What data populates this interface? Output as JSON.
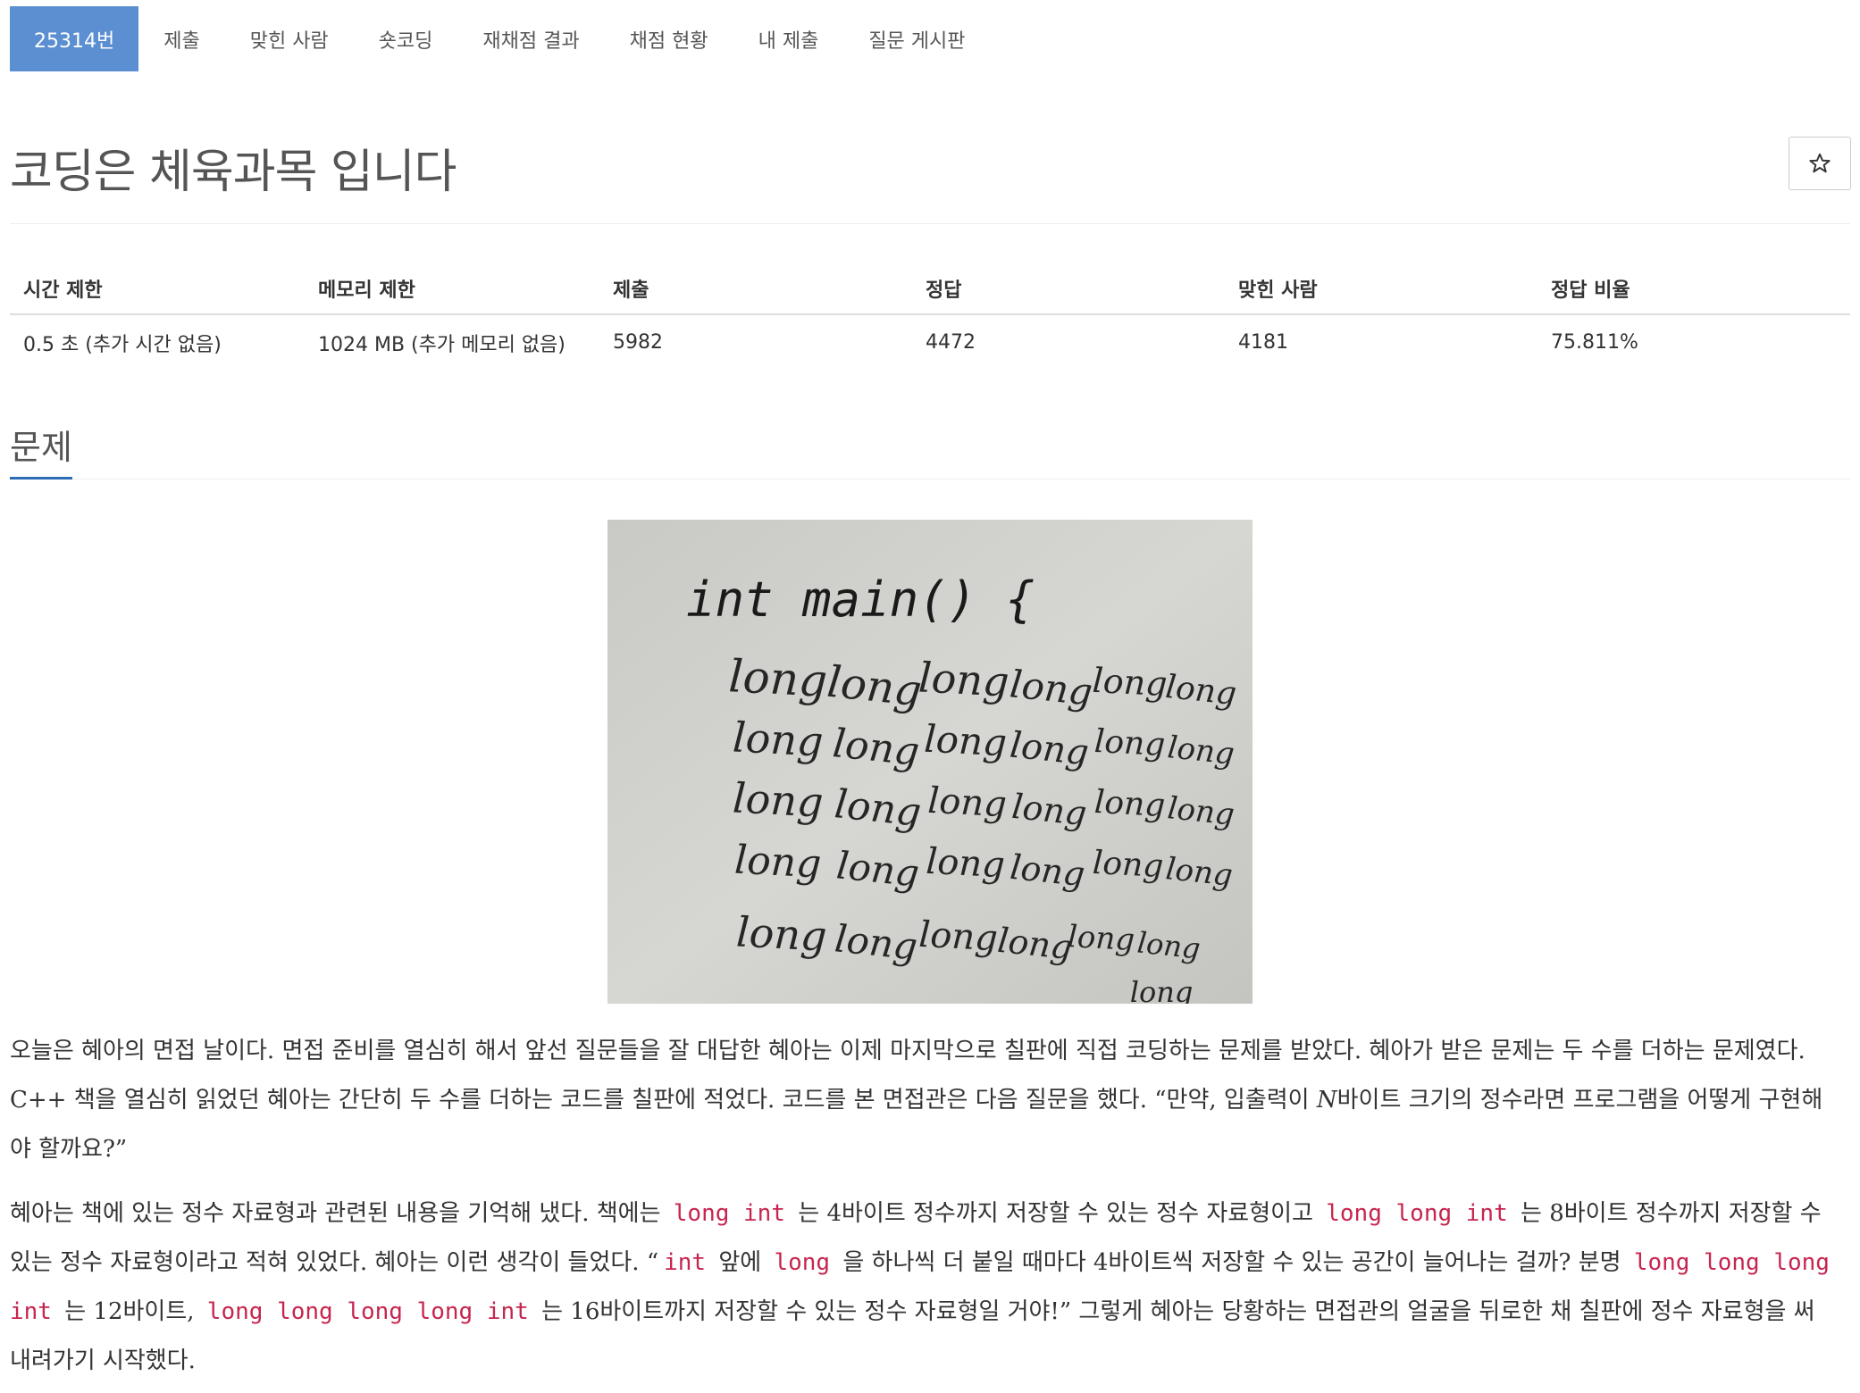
{
  "nav": {
    "tabs": [
      {
        "label": "25314번",
        "active": true
      },
      {
        "label": "제출",
        "active": false
      },
      {
        "label": "맞힌 사람",
        "active": false
      },
      {
        "label": "숏코딩",
        "active": false
      },
      {
        "label": "재채점 결과",
        "active": false
      },
      {
        "label": "채점 현황",
        "active": false
      },
      {
        "label": "내 제출",
        "active": false
      },
      {
        "label": "질문 게시판",
        "active": false
      }
    ]
  },
  "problem": {
    "title": "코딩은 체육과목 입니다",
    "star_icon": "star-outline-icon"
  },
  "stats": {
    "headers": [
      "시간 제한",
      "메모리 제한",
      "제출",
      "정답",
      "맞힌 사람",
      "정답 비율"
    ],
    "values": [
      "0.5 초 (추가 시간 없음)",
      "1024 MB (추가 메모리 없음)",
      "5982",
      "4472",
      "4181",
      "75.811%"
    ]
  },
  "section": {
    "heading": "문제"
  },
  "image": {
    "header_line": "int main() {",
    "word": "long"
  },
  "text": {
    "p1_a": "오늘은 혜아의 면접 날이다. 면접 준비를 열심히 해서 앞선 질문들을 잘 대답한 혜아는 이제 마지막으로 칠판에 직접 코딩하는 문제를 받았다. 혜아가 받은 문제는 두 수를 더하는 문제였다. C++ 책을 열심히 읽었던 혜아는 간단히 두 수를 더하는 코드를 칠판에 적었다. 코드를 본 면접관은 다음 질문을 했다. “만약, 입출력이 ",
    "p1_n": "N",
    "p1_b": "바이트 크기의 정수라면 프로그램을 어떻게 구현해야 할까요?”",
    "p2_1": "혜아는 책에 있는 정수 자료형과 관련된 내용을 기억해 냈다. 책에는 ",
    "c_long_int": "long int",
    "p2_2": " 는 4바이트 정수까지 저장할 수 있는 정수 자료형이고 ",
    "c_long_long_int": "long long int",
    "p2_3": " 는 8바이트 정수까지 저장할 수 있는 정수 자료형이라고 적혀 있었다. 혜아는 이런 생각이 들었다. “",
    "c_int": "int",
    "p2_4": " 앞에 ",
    "c_long": "long",
    "p2_5": " 을 하나씩 더 붙일 때마다 4바이트씩 저장할 수 있는 공간이 늘어나는 걸까? 분명 ",
    "c_long3_int": "long long long int",
    "p2_6": " 는 12바이트, ",
    "c_long4_int": "long long long long int",
    "p2_7": " 는 16바이트까지 저장할 수 있는 정수 자료형일 거야!” 그렇게 혜아는 당황하는 면접관의 얼굴을 뒤로한 채 칠판에 정수 자료형을 써 내려가기 시작했다."
  }
}
